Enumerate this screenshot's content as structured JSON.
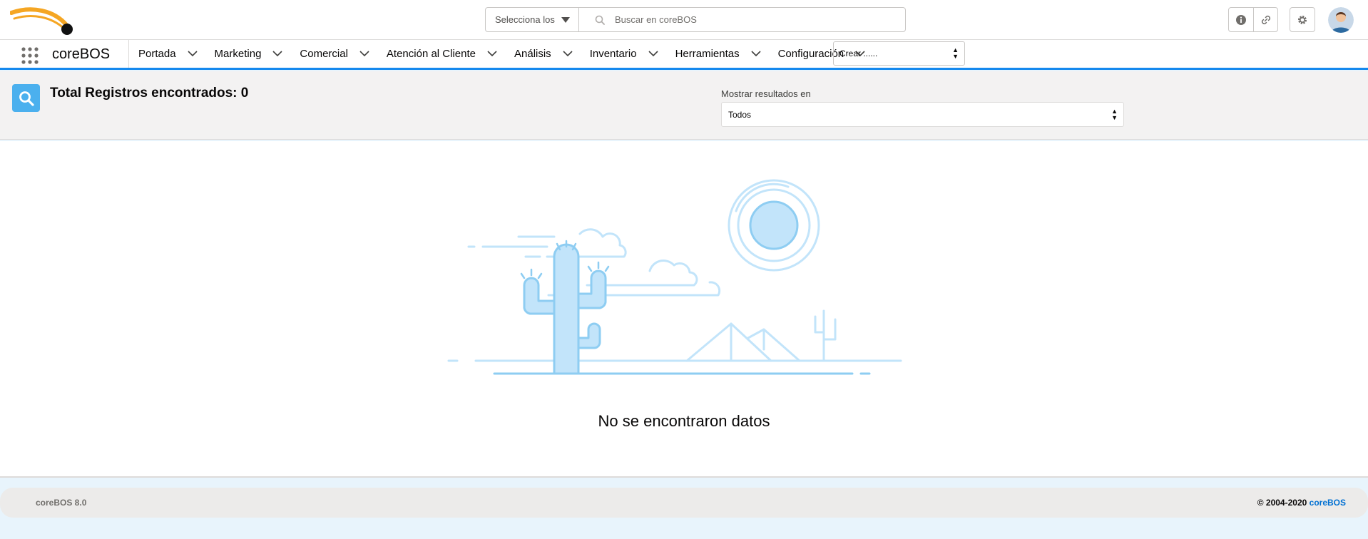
{
  "header": {
    "search_scope": "Selecciona los",
    "search_placeholder": "Buscar en coreBOS",
    "utility_icons": [
      "info-icon",
      "link-icon",
      "gear-icon"
    ]
  },
  "nav": {
    "app_name": "coreBOS",
    "items": [
      {
        "label": "Portada"
      },
      {
        "label": "Marketing"
      },
      {
        "label": "Comercial"
      },
      {
        "label": "Atención al Cliente"
      },
      {
        "label": "Análisis"
      },
      {
        "label": "Inventario"
      },
      {
        "label": "Herramientas"
      },
      {
        "label": "Configuración"
      }
    ],
    "create_select": "Crear ......"
  },
  "results": {
    "title": "Total Registros encontrados: 0",
    "show_label": "Mostrar resultados en",
    "show_value": "Todos"
  },
  "main": {
    "empty_message": "No se encontraron datos"
  },
  "footer": {
    "version": "coreBOS 8.0",
    "copyright": "© 2004-2020",
    "brand_link": "coreBOS"
  },
  "colors": {
    "accent": "#1589ee",
    "icon_blue": "#4bb0ee",
    "illustration_fill": "#c2e4fa",
    "illustration_stroke": "#8ecdf2",
    "logo_orange": "#f5a623"
  }
}
